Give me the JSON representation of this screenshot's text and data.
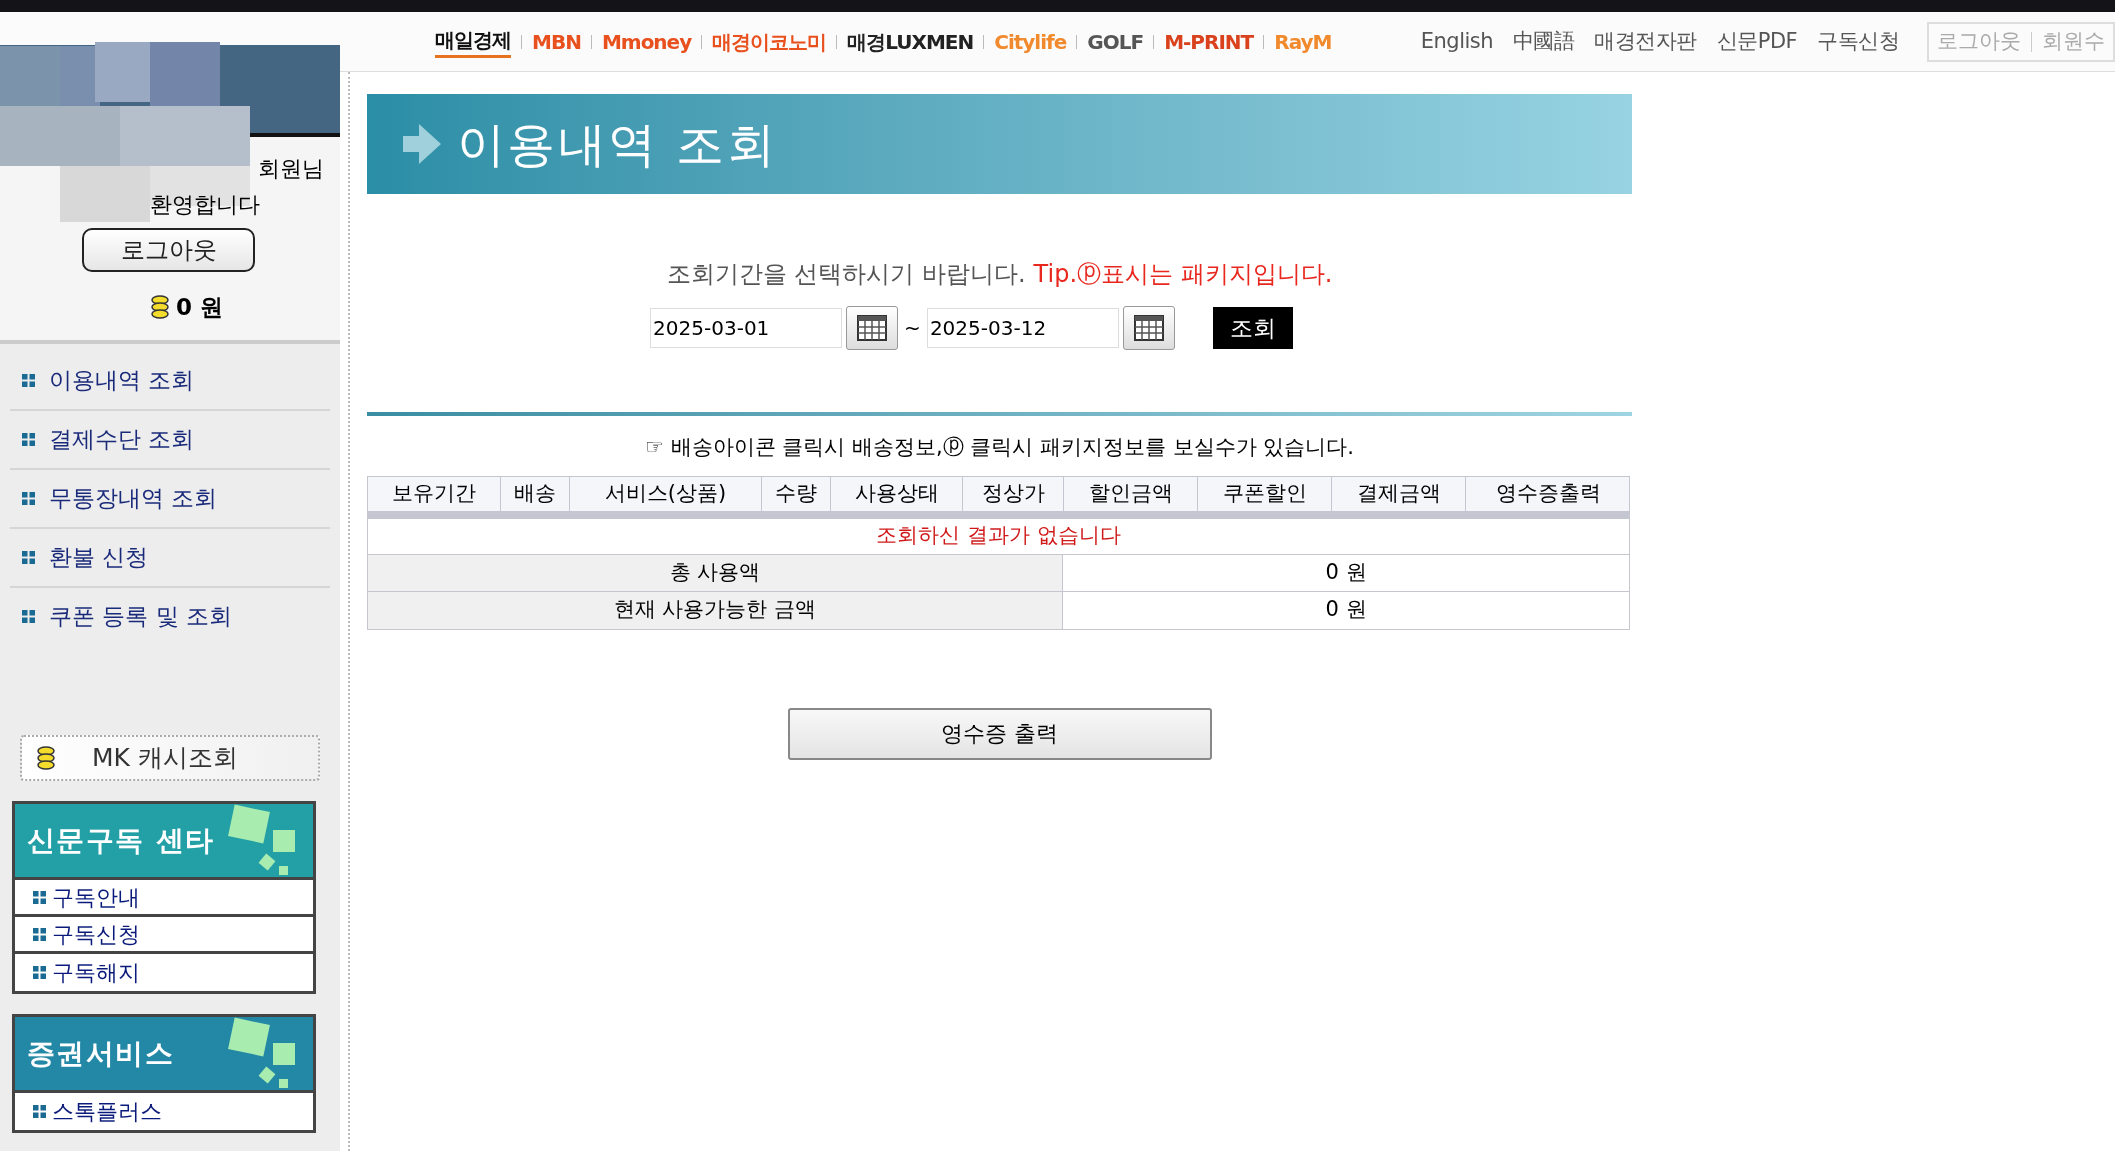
{
  "top_logos": [
    {
      "text": "매일경제",
      "color": "#111111"
    },
    {
      "text": "MBN",
      "color": "#e8501e"
    },
    {
      "text": "Mmoney",
      "color": "#e8501e"
    },
    {
      "text": "매경이코노미",
      "color": "#e8501e"
    },
    {
      "text": "매경LUXMEN",
      "color": "#222222"
    },
    {
      "text": "Citylife",
      "color": "#f08a2c"
    },
    {
      "text": "GOLF",
      "color": "#555555"
    },
    {
      "text": "M-PRINT",
      "color": "#d9421c"
    },
    {
      "text": "RayM",
      "color": "#f08a2c"
    }
  ],
  "top_links": [
    "English",
    "中國語",
    "매경전자판",
    "신문PDF",
    "구독신청"
  ],
  "account_links": [
    "로그아웃",
    "회원수"
  ],
  "sidebar": {
    "greeting": [
      "회원님",
      "환영합니다"
    ],
    "logout": "로그아웃",
    "balance": "0 원",
    "menu": [
      "이용내역 조회",
      "결제수단 조회",
      "무통장내역 조회",
      "환불 신청",
      "쿠폰 등록 및 조회"
    ],
    "cash_button": "MK 캐시조회",
    "boxes": [
      {
        "title": "신문구독 센타",
        "color": "#23a0a6",
        "items": [
          "구독안내",
          "구독신청",
          "구독해지"
        ]
      },
      {
        "title": "증권서비스",
        "color": "#2388a6",
        "items": [
          "스톡플러스"
        ]
      }
    ]
  },
  "main": {
    "title": "이용내역 조회",
    "prompt": "조회기간을 선택하시기 바랍니다.",
    "tip": "Tip.ⓟ표시는 패키지입니다.",
    "start_date": "2025-03-01",
    "range_sep": "~",
    "end_date": "2025-03-12",
    "search_button": "조회",
    "note": "☞ 배송아이콘 클릭시 배송정보,ⓟ 클릭시 패키지정보를 보실수가 있습니다.",
    "table": {
      "columns": [
        "보유기간",
        "배송",
        "서비스(상품)",
        "수량",
        "사용상태",
        "정상가",
        "할인금액",
        "쿠폰할인",
        "결제금액",
        "영수증출력"
      ],
      "empty_message": "조회하신 결과가 없습니다",
      "summary": [
        {
          "label": "총 사용액",
          "value": "0 원"
        },
        {
          "label": "현재 사용가능한 금액",
          "value": "0 원"
        }
      ]
    },
    "receipt_button": "영수증 출력"
  }
}
